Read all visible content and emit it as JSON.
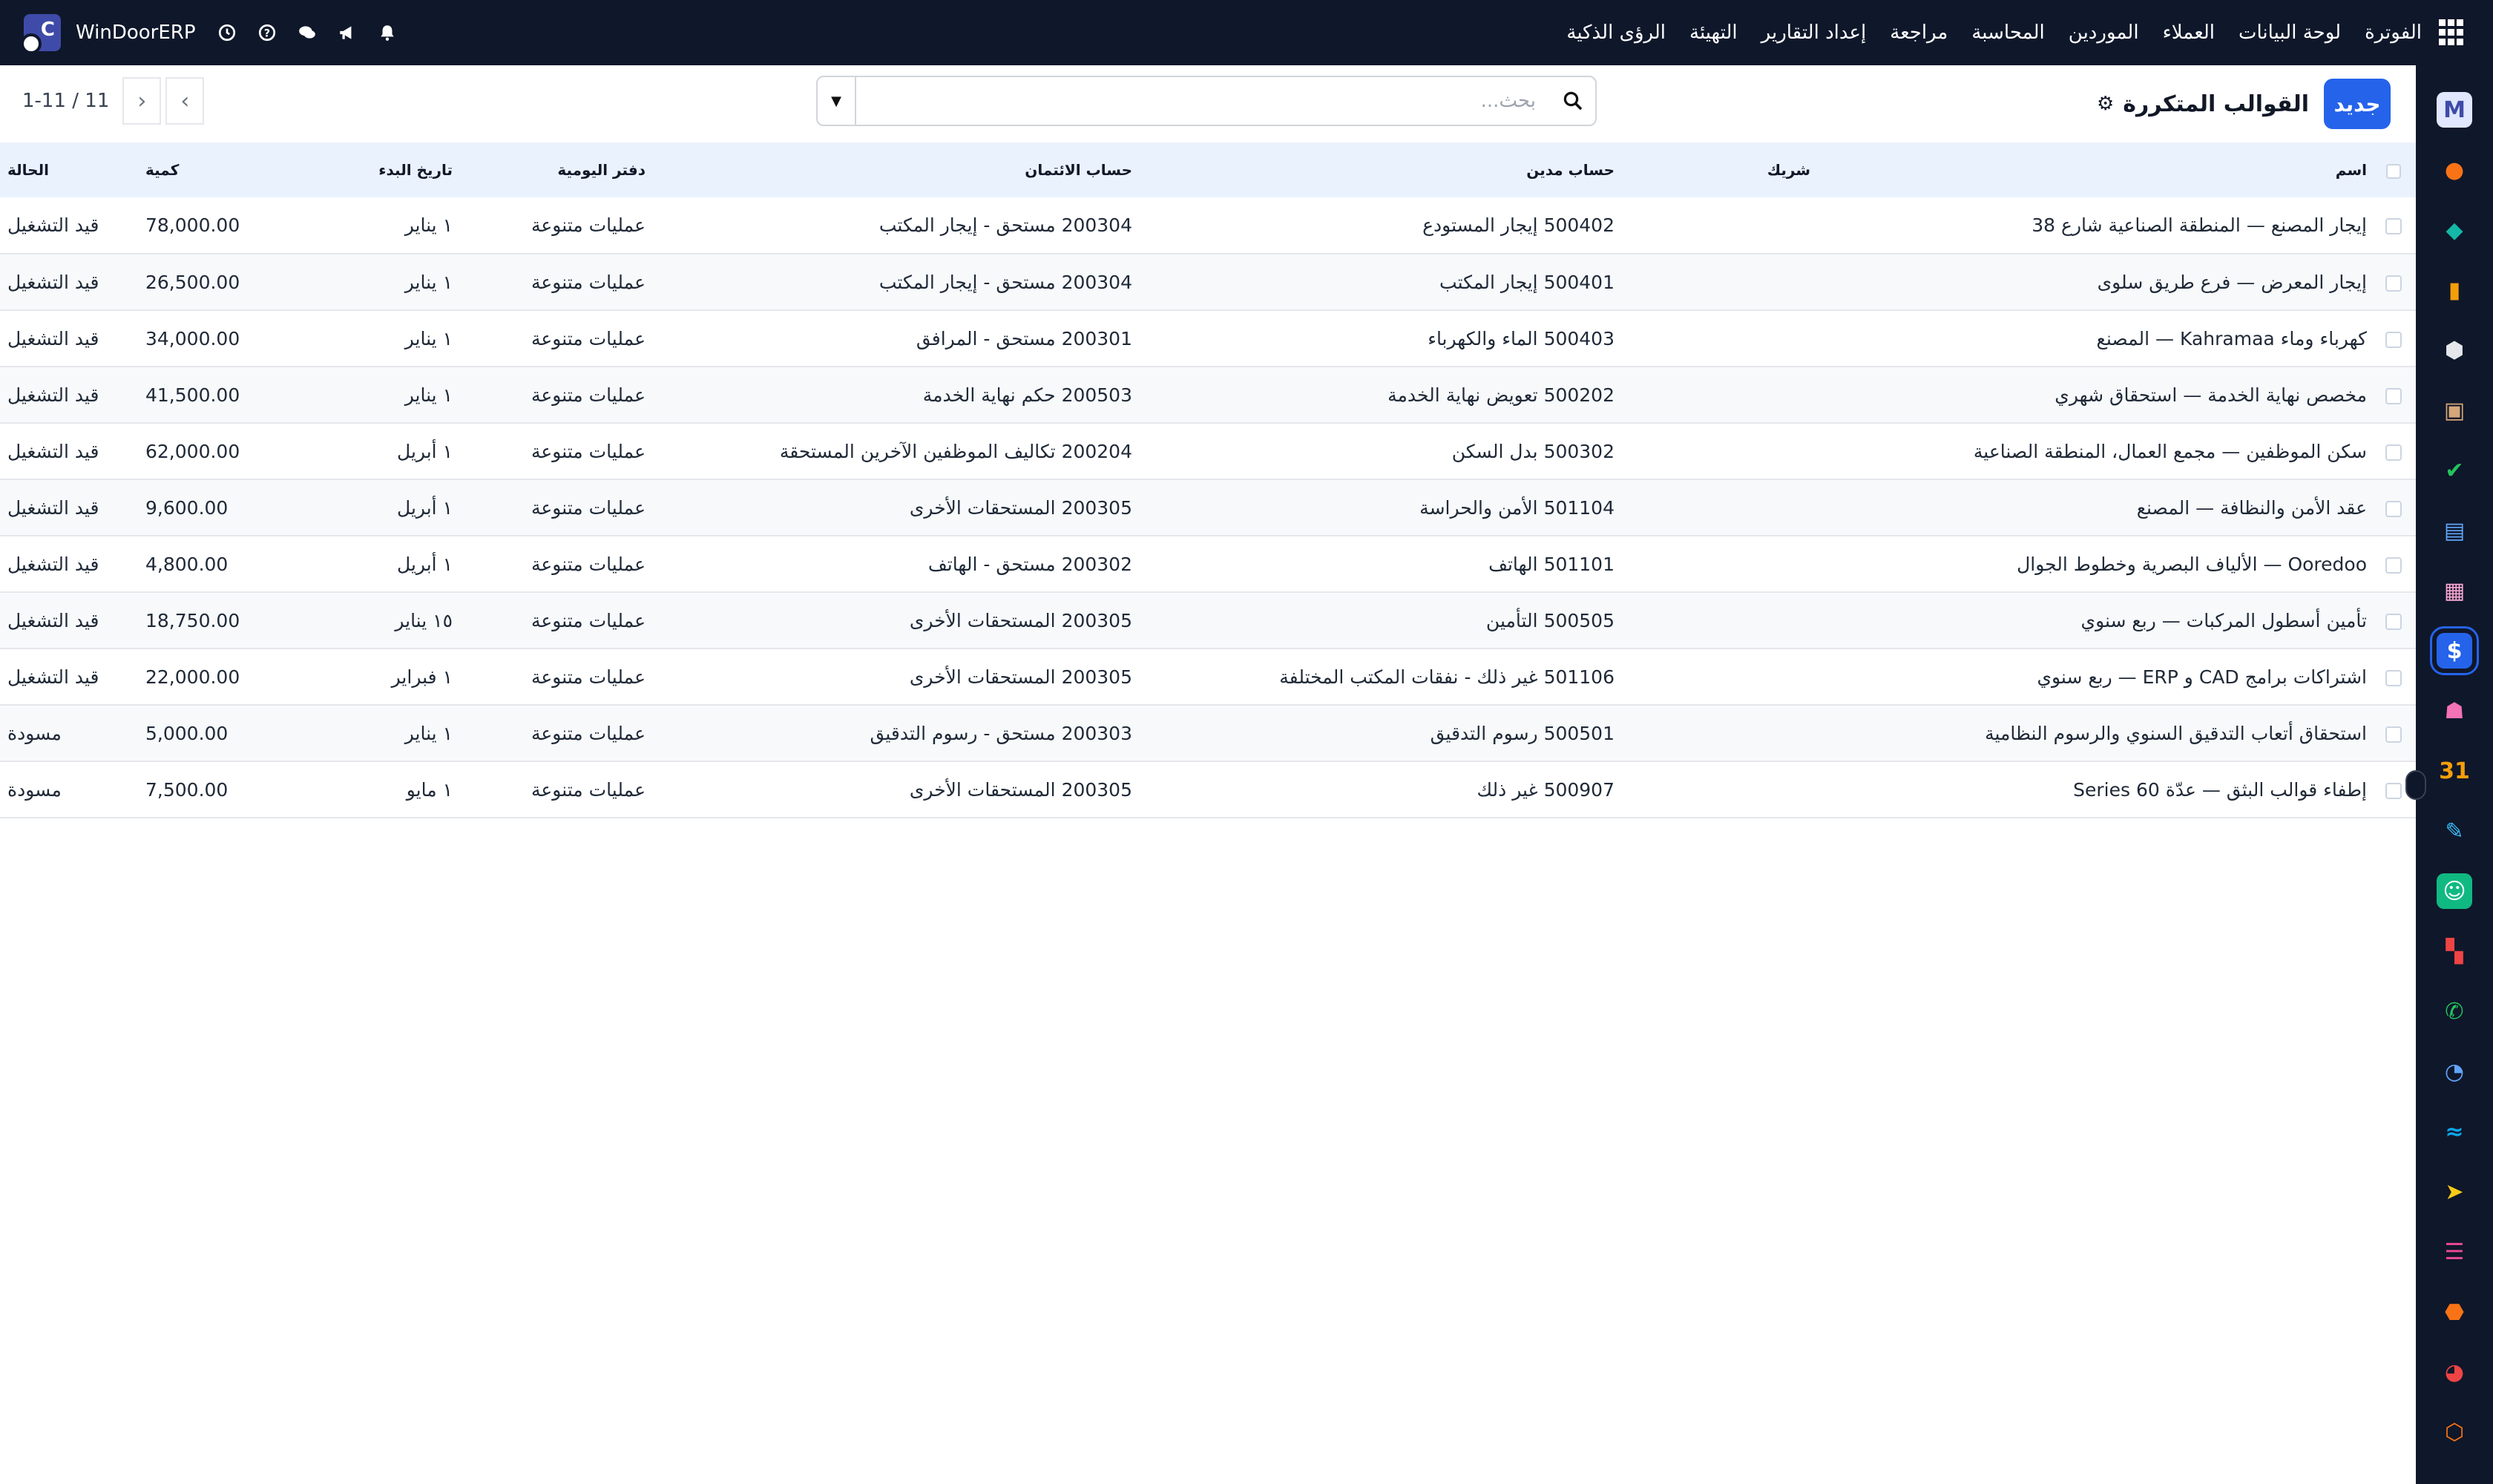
{
  "brand": {
    "name": "WinDoorERP",
    "letter": "C"
  },
  "menu": [
    "الفوترة",
    "لوحة البيانات",
    "العملاء",
    "الموردين",
    "المحاسبة",
    "مراجعة",
    "إعداد التقارير",
    "التهيئة",
    "الرؤى الذكية"
  ],
  "nav_icons": [
    "bell-icon",
    "megaphone-icon",
    "chat-icon",
    "help-icon",
    "clock-icon"
  ],
  "control": {
    "new_label": "جديد",
    "title": "القوالب المتكررة",
    "search_placeholder": "بحث...",
    "pager": "1-11 / 11"
  },
  "table": {
    "headers": {
      "name": "اسم",
      "partner": "شريك",
      "debit": "حساب مدين",
      "credit": "حساب الائتمان",
      "journal": "دفتر اليومية",
      "start": "تاريخ البدء",
      "amount": "كمية",
      "state": "الحالة"
    },
    "rows": [
      {
        "name": "إيجار المصنع — المنطقة الصناعية شارع 38",
        "partner": "",
        "debit": "500402 إيجار المستودع",
        "credit": "200304 مستحق - إيجار المكتب",
        "journal": "عمليات متنوعة",
        "start": "١ يناير",
        "amount": "78,000.00",
        "state": "قيد التشغيل"
      },
      {
        "name": "إيجار المعرض — فرع طريق سلوى",
        "partner": "",
        "debit": "500401 إيجار المكتب",
        "credit": "200304 مستحق - إيجار المكتب",
        "journal": "عمليات متنوعة",
        "start": "١ يناير",
        "amount": "26,500.00",
        "state": "قيد التشغيل"
      },
      {
        "name": "كهرباء وماء Kahramaa — المصنع",
        "partner": "",
        "debit": "500403 الماء والكهرباء",
        "credit": "200301 مستحق - المرافق",
        "journal": "عمليات متنوعة",
        "start": "١ يناير",
        "amount": "34,000.00",
        "state": "قيد التشغيل"
      },
      {
        "name": "مخصص نهاية الخدمة — استحقاق شهري",
        "partner": "",
        "debit": "500202 تعويض نهاية الخدمة",
        "credit": "200503 حكم نهاية الخدمة",
        "journal": "عمليات متنوعة",
        "start": "١ يناير",
        "amount": "41,500.00",
        "state": "قيد التشغيل"
      },
      {
        "name": "سكن الموظفين — مجمع العمال، المنطقة الصناعية",
        "partner": "",
        "debit": "500302 بدل السكن",
        "credit": "200204 تكاليف الموظفين الآخرين المستحقة",
        "journal": "عمليات متنوعة",
        "start": "١ أبريل",
        "amount": "62,000.00",
        "state": "قيد التشغيل"
      },
      {
        "name": "عقد الأمن والنظافة — المصنع",
        "partner": "",
        "debit": "501104 الأمن والحراسة",
        "credit": "200305 المستحقات الأخرى",
        "journal": "عمليات متنوعة",
        "start": "١ أبريل",
        "amount": "9,600.00",
        "state": "قيد التشغيل"
      },
      {
        "name": "Ooredoo — الألياف البصرية وخطوط الجوال",
        "partner": "",
        "debit": "501101 الهاتف",
        "credit": "200302 مستحق - الهاتف",
        "journal": "عمليات متنوعة",
        "start": "١ أبريل",
        "amount": "4,800.00",
        "state": "قيد التشغيل"
      },
      {
        "name": "تأمين أسطول المركبات — ربع سنوي",
        "partner": "",
        "debit": "500505 التأمين",
        "credit": "200305 المستحقات الأخرى",
        "journal": "عمليات متنوعة",
        "start": "١٥ يناير",
        "amount": "18,750.00",
        "state": "قيد التشغيل"
      },
      {
        "name": "اشتراكات برامج CAD و ERP — ربع سنوي",
        "partner": "",
        "debit": "501106 غير ذلك - نفقات المكتب المختلفة",
        "credit": "200305 المستحقات الأخرى",
        "journal": "عمليات متنوعة",
        "start": "١ فبراير",
        "amount": "22,000.00",
        "state": "قيد التشغيل"
      },
      {
        "name": "استحقاق أتعاب التدقيق السنوي والرسوم النظامية",
        "partner": "",
        "debit": "500501 رسوم التدقيق",
        "credit": "200303 مستحق - رسوم التدقيق",
        "journal": "عمليات متنوعة",
        "start": "١ يناير",
        "amount": "5,000.00",
        "state": "مسودة"
      },
      {
        "name": "إطفاء قوالب البثق — عدّة Series 60",
        "partner": "",
        "debit": "500907 غير ذلك",
        "credit": "200305 المستحقات الأخرى",
        "journal": "عمليات متنوعة",
        "start": "١ مايو",
        "amount": "7,500.00",
        "state": "مسودة"
      }
    ]
  },
  "sidebar_apps": [
    {
      "icon": "mail-app-icon",
      "glyph": "M",
      "bg": "#e0e7ff",
      "fg": "#3f4ba8"
    },
    {
      "icon": "chat-app-icon",
      "glyph": "●",
      "bg": "transparent",
      "fg": "#f97316"
    },
    {
      "icon": "shapes-app-icon",
      "glyph": "◆",
      "bg": "transparent",
      "fg": "#14b8a6"
    },
    {
      "icon": "chart-app-icon",
      "glyph": "▮",
      "bg": "transparent",
      "fg": "#f59e0b"
    },
    {
      "icon": "cube-app-icon",
      "glyph": "⬢",
      "bg": "transparent",
      "fg": "#e5e7eb"
    },
    {
      "icon": "portrait-app-icon",
      "glyph": "▣",
      "bg": "transparent",
      "fg": "#d6a77a"
    },
    {
      "icon": "check-app-icon",
      "glyph": "✔",
      "bg": "transparent",
      "fg": "#22c55e"
    },
    {
      "icon": "book-app-icon",
      "glyph": "▤",
      "bg": "transparent",
      "fg": "#60a5fa"
    },
    {
      "icon": "box-app-icon",
      "glyph": "▦",
      "bg": "transparent",
      "fg": "#f9a8d4"
    },
    {
      "icon": "invoice-app-icon",
      "glyph": "$",
      "bg": "#2563eb",
      "fg": "#ffffff",
      "active": true
    },
    {
      "icon": "people-app-icon",
      "glyph": "☗",
      "bg": "transparent",
      "fg": "#f472b6"
    },
    {
      "icon": "calendar-app-icon",
      "glyph": "31",
      "bg": "transparent",
      "fg": "#f59e0b"
    },
    {
      "icon": "sign-app-icon",
      "glyph": "✎",
      "bg": "transparent",
      "fg": "#38bdf8"
    },
    {
      "icon": "contacts-app-icon",
      "glyph": "☺",
      "bg": "#10b981",
      "fg": "#ffffff"
    },
    {
      "icon": "dashboard-app-icon",
      "glyph": "▚",
      "bg": "transparent",
      "fg": "#ef4444"
    },
    {
      "icon": "whatsapp-app-icon",
      "glyph": "✆",
      "bg": "transparent",
      "fg": "#22c55e"
    },
    {
      "icon": "clock-app-icon",
      "glyph": "◔",
      "bg": "transparent",
      "fg": "#60a5fa"
    },
    {
      "icon": "wave-app-icon",
      "glyph": "≈",
      "bg": "transparent",
      "fg": "#0ea5e9"
    },
    {
      "icon": "send-app-icon",
      "glyph": "➤",
      "bg": "transparent",
      "fg": "#facc15"
    },
    {
      "icon": "layers-app-icon",
      "glyph": "☰",
      "bg": "transparent",
      "fg": "#ec4899"
    },
    {
      "icon": "hexagon-app-icon",
      "glyph": "⬣",
      "bg": "transparent",
      "fg": "#f97316"
    },
    {
      "icon": "pie-app-icon",
      "glyph": "◕",
      "bg": "transparent",
      "fg": "#ef4444"
    },
    {
      "icon": "settings-app-icon",
      "glyph": "⬡",
      "bg": "transparent",
      "fg": "#f97316"
    }
  ]
}
